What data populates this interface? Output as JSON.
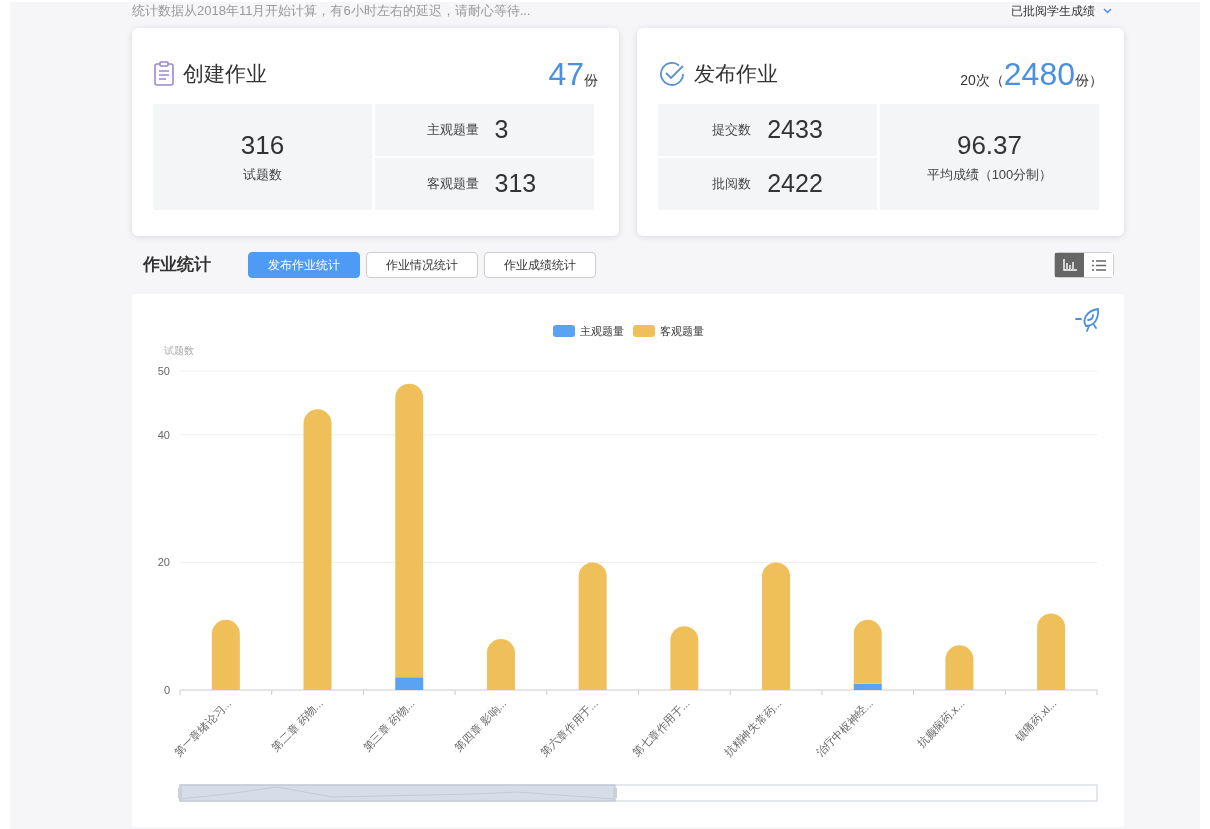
{
  "notice": "统计数据从2018年11月开始计算，有6小时左右的延迟，请耐心等待...",
  "filter": {
    "label": "已批阅学生成绩"
  },
  "cards": [
    {
      "kind": "create",
      "title": "创建作业",
      "summary": [
        {
          "text": "47",
          "big": true
        },
        {
          "text": "份",
          "big": false
        }
      ],
      "main": {
        "value": "316",
        "label": "试题数"
      },
      "rows": [
        {
          "label": "主观题量",
          "value": "3"
        },
        {
          "label": "客观题量",
          "value": "313"
        }
      ]
    },
    {
      "kind": "publish",
      "title": "发布作业",
      "summary": [
        {
          "text": "20",
          "big": false
        },
        {
          "text": "次（",
          "big": false
        },
        {
          "text": "2480",
          "big": true
        },
        {
          "text": "份）",
          "big": false
        }
      ],
      "rows": [
        {
          "label": "提交数",
          "value": "2433"
        },
        {
          "label": "批阅数",
          "value": "2422"
        }
      ],
      "main": {
        "value": "96.37",
        "label": "平均成绩（100分制）"
      }
    }
  ],
  "section": {
    "title": "作业统计",
    "tabs": [
      {
        "label": "发布作业统计",
        "selected": true
      },
      {
        "label": "作业情况统计",
        "selected": false
      },
      {
        "label": "作业成绩统计",
        "selected": false
      }
    ],
    "views": [
      {
        "kind": "chart",
        "selected": true
      },
      {
        "kind": "list",
        "selected": false
      }
    ]
  },
  "chart_data": {
    "type": "bar",
    "stacked": true,
    "legend": true,
    "ylabel": "试题数",
    "ylim": [
      0,
      50
    ],
    "yticks": [
      0,
      20,
      40,
      50
    ],
    "categories": [
      "第一章绪论习...",
      "第二章 药物...",
      "第三章 药物...",
      "第四章 影响...",
      "第六章作用于...",
      "第七章作用于...",
      "抗精神失常药...",
      "治疗中枢神经...",
      "抗癫痫药.x...",
      "镇痛药.xl..."
    ],
    "series": [
      {
        "name": "主观题量",
        "color": "#5aa2f2",
        "values": [
          0,
          0,
          2,
          0,
          0,
          0,
          0,
          1,
          0,
          0
        ]
      },
      {
        "name": "客观题量",
        "color": "#efc05a",
        "values": [
          11,
          44,
          46,
          8,
          20,
          10,
          20,
          10,
          7,
          12
        ]
      }
    ]
  }
}
